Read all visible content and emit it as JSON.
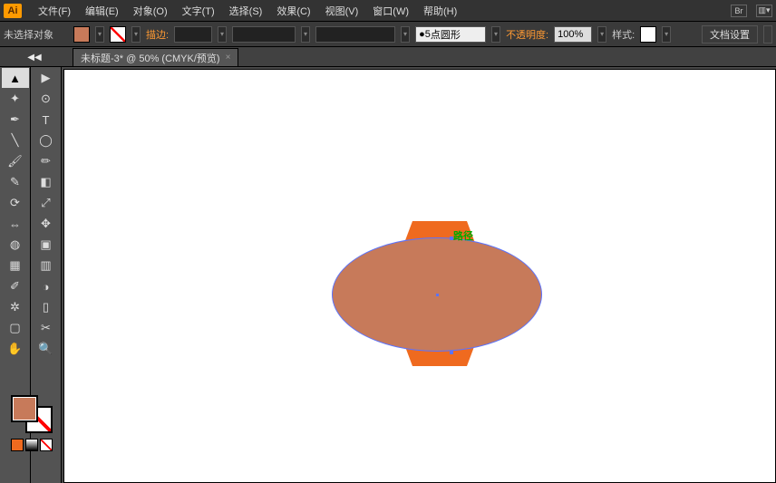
{
  "app": {
    "logo": "Ai"
  },
  "menu": [
    "文件(F)",
    "编辑(E)",
    "对象(O)",
    "文字(T)",
    "选择(S)",
    "效果(C)",
    "视图(V)",
    "窗口(W)",
    "帮助(H)"
  ],
  "menu_right": {
    "br": "Br"
  },
  "control": {
    "no_selection": "未选择对象",
    "fill_color": "#c77a5a",
    "stroke_label": "描边:",
    "stroke_weight": "",
    "brush_default": "",
    "brush_profile_prefix": "5",
    "brush_profile": "点圆形",
    "opacity_label": "不透明度:",
    "opacity_value": "100%",
    "style_label": "样式:",
    "doc_setup": "文档设置"
  },
  "tab": {
    "title": "未标题-3* @ 50% (CMYK/预览)",
    "close": "×"
  },
  "tools_left": [
    "select",
    "direct",
    "wand",
    "lasso",
    "pen",
    "type",
    "line",
    "ellipse",
    "brush",
    "pencil",
    "blob",
    "eraser",
    "rotate",
    "scale",
    "width",
    "warp",
    "shapebuilder",
    "mesh",
    "gradient",
    "eyedrop",
    "blend",
    "symbol",
    "graph",
    "artboard",
    "slice",
    "hand",
    "zoom"
  ],
  "colors": {
    "fill": "#c77a5a",
    "stroke": "none",
    "tri": [
      "#ef6a1f",
      "#333333",
      "#ffffff"
    ]
  },
  "canvas": {
    "hex_color": "#ef6a1f",
    "ellipse_fill": "#c77a5a",
    "ellipse_stroke": "#5b73ff",
    "path_label": "路径"
  }
}
